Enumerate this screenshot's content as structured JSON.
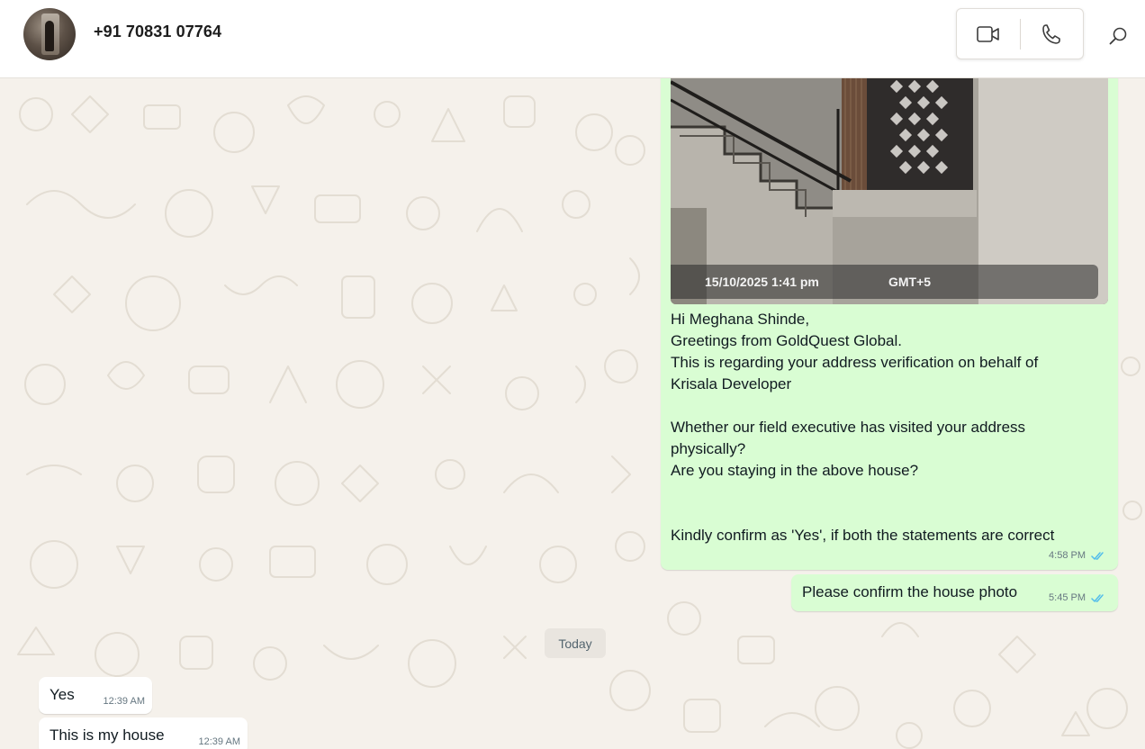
{
  "header": {
    "contact_name": "+91 70831 07764",
    "video_call_icon": "video-camera-icon",
    "voice_call_icon": "phone-icon",
    "search_icon": "search-icon"
  },
  "messages": {
    "outgoing_image": {
      "photo_date": "15/10/2025 1:41 pm",
      "photo_timezone": "GMT+5",
      "lines": [
        "Hi Meghana Shinde,",
        "Greetings from GoldQuest Global.",
        "This is regarding your address verification on behalf of",
        "Krisala Developer",
        "",
        "Whether our field executive has visited your address",
        "physically?",
        "Are you staying in the above house?",
        "",
        "",
        "Kindly confirm as 'Yes', if both the statements are correct"
      ],
      "time": "4:58 PM",
      "status_icon": "double-check-read-icon"
    },
    "outgoing_2": {
      "text": "Please confirm the house photo",
      "time": "5:45 PM",
      "status_icon": "double-check-read-icon"
    },
    "day_separator": "Today",
    "incoming": [
      {
        "text": "Yes",
        "time": "12:39 AM"
      },
      {
        "text": "This is my house",
        "time": "12:39 AM"
      }
    ]
  },
  "colors": {
    "outgoing_bubble": "#d9fdd3",
    "incoming_bubble": "#ffffff",
    "chat_background": "#f5f1eb",
    "read_tick": "#53bdeb"
  }
}
